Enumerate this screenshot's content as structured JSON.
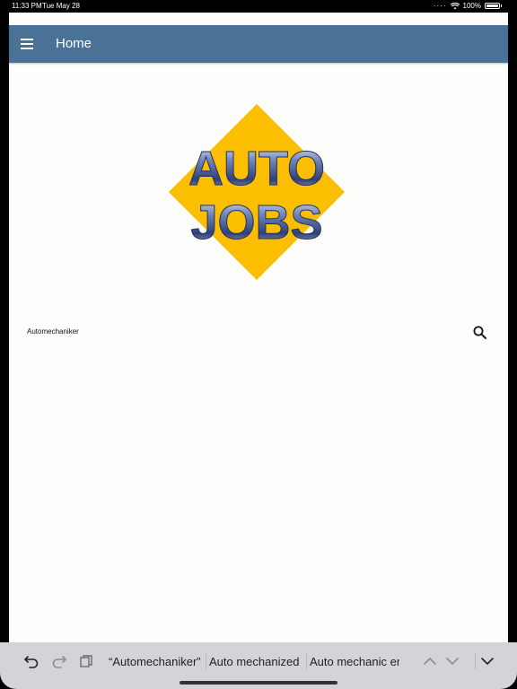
{
  "status": {
    "time": "11:33 PM",
    "date": "Tue May 28",
    "battery": "100%"
  },
  "header": {
    "title": "Home"
  },
  "logo": {
    "line1": "AUTO",
    "line2": "JOBS",
    "diamond_color": "#fbbe00",
    "text_color": "#3b4f8a"
  },
  "search": {
    "value": "Automechaniker",
    "placeholder": ""
  },
  "keyboard": {
    "suggestions": [
      "“Automechaniker”",
      "Auto mechanized",
      "Auto mechanic era"
    ]
  },
  "colors": {
    "header_bg": "#4a7196",
    "page_bg": "#fdfdfc",
    "keyboard_bg": "#d2d4d9"
  }
}
